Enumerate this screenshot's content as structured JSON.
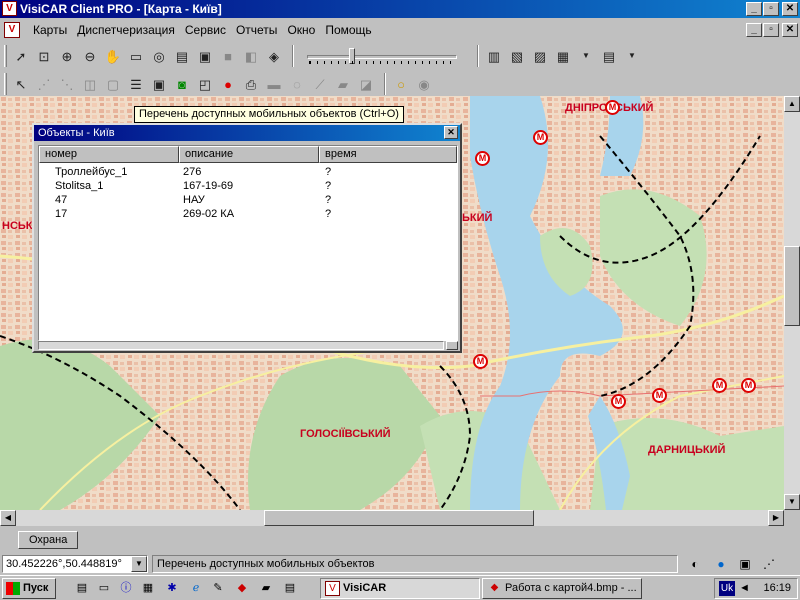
{
  "window": {
    "title": "VisiCAR Client PRO - [Карта - Київ]",
    "minimize": "_",
    "maximize": "▫",
    "close": "✕"
  },
  "menu": {
    "items": [
      "Карты",
      "Диспетчеризация",
      "Сервис",
      "Отчеты",
      "Окно",
      "Помощь"
    ]
  },
  "toolbar1": {
    "icons": [
      "arrow-select-icon",
      "zoom-rect-icon",
      "zoom-in-icon",
      "zoom-out-icon",
      "hand-pan-icon",
      "full-extent-icon",
      "binoculars-icon",
      "layers-icon",
      "label-icon",
      "map-a-icon",
      "map-b-icon",
      "map-c-icon",
      "map-d-icon",
      "print-layers-icon"
    ],
    "right_icons": [
      "report-1-icon",
      "report-2-icon",
      "report-3-icon",
      "report-4-icon",
      "report-5-icon"
    ]
  },
  "toolbar2": {
    "icons": [
      "pointer-icon",
      "node-icon",
      "vertex-icon",
      "object-icon",
      "object-edit-icon",
      "list-icon",
      "vehicle-list-icon",
      "add-vehicle-icon",
      "vehicle-info-icon",
      "record-icon",
      "printer-icon",
      "message-icon",
      "track-icon",
      "route-icon",
      "folder-icon",
      "copy-icon",
      "circle-icon",
      "layers-toggle-icon"
    ]
  },
  "tooltip": "Перечень доступных мобильных объектов (Ctrl+O)",
  "objects_window": {
    "title": "Объекты - Київ",
    "close": "✕",
    "columns": [
      "номер",
      "описание",
      "время"
    ],
    "rows": [
      {
        "number": "Троллейбус_1",
        "description": "276",
        "time": "?"
      },
      {
        "number": "Stolitsa_1",
        "description": "167-19-69",
        "time": "?"
      },
      {
        "number": "47",
        "description": "НАУ",
        "time": "?"
      },
      {
        "number": "17",
        "description": "269-02 КА",
        "time": "?"
      }
    ]
  },
  "map": {
    "districts": {
      "dnipro": "ДНІПРОВСЬКИЙ",
      "holosiiv": "ГОЛОСІЇВСЬКИЙ",
      "darnytsia": "ДАРНИЦЬКИЙ",
      "left_partial": "НСЬК",
      "center_partial": "ЬКИЙ"
    },
    "metro_glyph": "М",
    "colors": {
      "water": "#a8d4ec",
      "urban": "#f0dcc8",
      "parks": "#b8d8a8",
      "district_label": "#c8001e"
    }
  },
  "tabs": {
    "guard": "Охрана"
  },
  "status": {
    "coords": "30.452226°,50.448819°",
    "text": "Перечень доступных мобильных объектов"
  },
  "taskbar": {
    "start": "Пуск",
    "tasks": [
      "VisiCAR",
      "Работа с картой4.bmp - ..."
    ],
    "lang": "Uk",
    "time": "16:19"
  }
}
